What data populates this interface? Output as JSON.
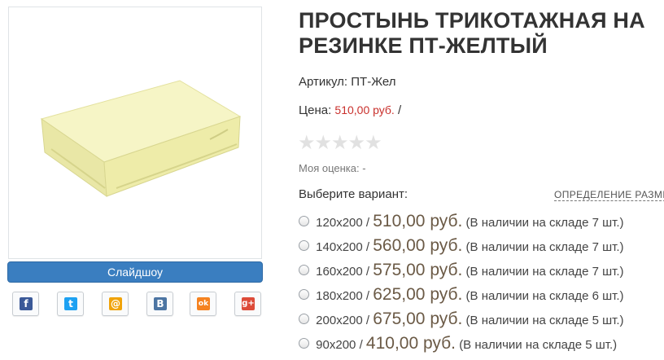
{
  "product": {
    "title": "ПРОСТЫНЬ ТРИКОТАЖНАЯ НА\nРЕЗИНКЕ ПТ-ЖЕЛТЫЙ",
    "sku_label": "Артикул:",
    "sku_value": "ПТ-Жел",
    "price_label": "Цена:",
    "price_value": "510,00 руб.",
    "price_suffix": "/",
    "image_color": "#f3f2b6"
  },
  "rating": {
    "stars": [
      "★",
      "★",
      "★",
      "★",
      "★"
    ],
    "my_rating_text": "Моя оценка: -"
  },
  "gallery": {
    "slideshow_label": "Слайдшоу"
  },
  "share": [
    {
      "name": "facebook-icon",
      "glyph": "f",
      "color": "#3b5998"
    },
    {
      "name": "twitter-icon",
      "glyph": "t",
      "color": "#1da1f2"
    },
    {
      "name": "email-icon",
      "glyph": "@",
      "color": "#f0a30a"
    },
    {
      "name": "vkontakte-icon",
      "glyph": "B",
      "color": "#4c75a3"
    },
    {
      "name": "odnoklassniki-icon",
      "glyph": "ok",
      "color": "#f58220"
    },
    {
      "name": "googleplus-icon",
      "glyph": "g+",
      "color": "#dd4b39"
    }
  ],
  "variants": {
    "label": "Выберите вариант:",
    "size_link": "ОПРЕДЕЛЕНИЕ РАЗМЕ",
    "items": [
      {
        "size": "120x200",
        "sep": "/",
        "price": "510,00 руб.",
        "stock": "(В наличии на складе 7 шт.)"
      },
      {
        "size": "140x200",
        "sep": "/",
        "price": "560,00 руб.",
        "stock": "(В наличии на складе 7 шт.)"
      },
      {
        "size": "160x200",
        "sep": "/",
        "price": "575,00 руб.",
        "stock": "(В наличии на складе 7 шт.)"
      },
      {
        "size": "180x200",
        "sep": "/",
        "price": "625,00 руб.",
        "stock": "(В наличии на складе 6 шт.)"
      },
      {
        "size": "200x200",
        "sep": "/",
        "price": "675,00 руб.",
        "stock": "(В наличии на складе 5 шт.)"
      },
      {
        "size": "90x200",
        "sep": "/",
        "price": "410,00 руб.",
        "stock": "(В наличии на складе 5 шт.)"
      }
    ]
  }
}
